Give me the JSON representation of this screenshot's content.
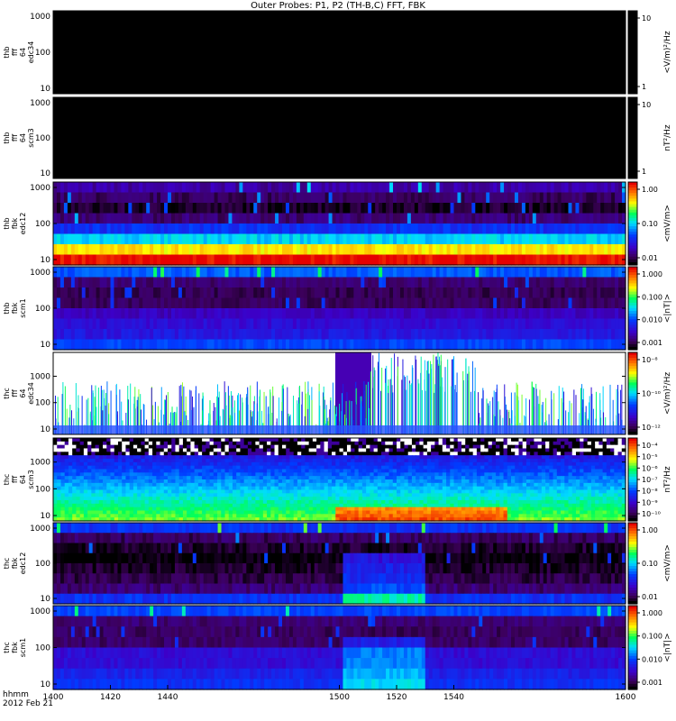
{
  "title": "Outer Probes: P1, P2 (TH-B,C) FFT, FBK",
  "time_axis": {
    "label_line1": "hhmm",
    "label_line2": "2012 Feb 21",
    "ticks": [
      "1400",
      "1420",
      "1440",
      "1500",
      "1520",
      "1540",
      "1600"
    ],
    "range": [
      1400,
      1600
    ]
  },
  "chart_data": [
    {
      "type": "heatmap",
      "panel_label": [
        "thb",
        "fff",
        "64",
        "edc34"
      ],
      "y_scale": "log",
      "ylim": [
        10,
        1000
      ],
      "y_ticks": [
        "1000",
        "100",
        "10"
      ],
      "colorbar_label": "<V/m)²/Hz",
      "colorbar_ticks": [
        "10",
        "1"
      ],
      "colorbar_scale": "log",
      "colorbar_range": [
        1,
        10
      ],
      "status": "no data (solid black)"
    },
    {
      "type": "heatmap",
      "panel_label": [
        "thb",
        "fff",
        "64",
        "scm3"
      ],
      "y_scale": "log",
      "ylim": [
        10,
        1000
      ],
      "y_ticks": [
        "1000",
        "100",
        "10"
      ],
      "colorbar_label": "nT²/Hz",
      "colorbar_ticks": [
        "10",
        "1"
      ],
      "colorbar_scale": "log",
      "colorbar_range": [
        1,
        10
      ],
      "status": "no data (solid black)"
    },
    {
      "type": "heatmap",
      "panel_label": [
        "thb",
        "fbk",
        "edc12"
      ],
      "y_scale": "log",
      "ylim": [
        10,
        1000
      ],
      "y_ticks": [
        "1000",
        "100",
        "10"
      ],
      "colorbar_label": "<mV/m>",
      "colorbar_ticks": [
        "1.00",
        "0.10",
        "0.01"
      ],
      "colorbar_scale": "log",
      "colorbar_range": [
        0.005,
        1.5
      ],
      "band_levels": [
        0.012,
        0.008,
        0.006,
        0.009,
        0.03,
        0.08,
        0.4,
        1.4
      ],
      "time_variation": "steady, sporadic narrow bursts at high frequency"
    },
    {
      "type": "heatmap",
      "panel_label": [
        "thb",
        "fbk",
        "scm1"
      ],
      "y_scale": "log",
      "ylim": [
        10,
        1000
      ],
      "y_ticks": [
        "1000",
        "100",
        "10"
      ],
      "colorbar_label": "<|nT|>",
      "colorbar_ticks": [
        "1.000",
        "0.100",
        "0.010",
        "0.001"
      ],
      "colorbar_scale": "log",
      "colorbar_range": [
        0.0007,
        1.5
      ],
      "band_levels": [
        0.012,
        0.0015,
        0.0012,
        0.0013,
        0.003,
        0.004,
        0.005,
        0.01
      ],
      "time_variation": "steady, weak"
    },
    {
      "type": "heatmap",
      "panel_label": [
        "thc",
        "fff",
        "64",
        "edc34"
      ],
      "y_scale": "log",
      "ylim": [
        10,
        5000
      ],
      "y_ticks": [
        "1000",
        "100",
        "10"
      ],
      "colorbar_label": "<V/m)²/Hz",
      "colorbar_ticks": [
        "10⁻⁸",
        "10⁻¹⁰",
        "10⁻¹²"
      ],
      "colorbar_scale": "log",
      "colorbar_range": [
        1e-13,
        1e-07
      ],
      "background": "white (below threshold)",
      "time_variation": "sparse spiky emissions; enhanced broadband activity 1500–1530"
    },
    {
      "type": "heatmap",
      "panel_label": [
        "thc",
        "fff",
        "64",
        "scm3"
      ],
      "y_scale": "log",
      "ylim": [
        10,
        5000
      ],
      "y_ticks": [
        "1000",
        "100",
        "10"
      ],
      "colorbar_label": "nT²/Hz",
      "colorbar_ticks": [
        "10⁻⁴",
        "10⁻⁵",
        "10⁻⁶",
        "10⁻⁷",
        "10⁻⁸",
        "10⁻⁹",
        "10⁻¹⁰"
      ],
      "colorbar_scale": "log",
      "colorbar_range": [
        1e-11,
        0.001
      ],
      "time_variation": "low-frequency enhancement (red/yellow) 1500–1530"
    },
    {
      "type": "heatmap",
      "panel_label": [
        "thc",
        "fbk",
        "edc12"
      ],
      "y_scale": "log",
      "ylim": [
        10,
        1000
      ],
      "y_ticks": [
        "1000",
        "100",
        "10"
      ],
      "colorbar_label": "<mV/m>",
      "colorbar_ticks": [
        "1.00",
        "0.10",
        "0.01"
      ],
      "colorbar_scale": "log",
      "colorbar_range": [
        0.005,
        1.5
      ],
      "band_levels": [
        0.03,
        0.008,
        0.006,
        0.005,
        0.006,
        0.007,
        0.009,
        0.03
      ],
      "time_variation": "enhancement 1500–1530"
    },
    {
      "type": "heatmap",
      "panel_label": [
        "thc",
        "fbk",
        "scm1"
      ],
      "y_scale": "log",
      "ylim": [
        10,
        1000
      ],
      "y_ticks": [
        "1000",
        "100",
        "10"
      ],
      "colorbar_label": "<|nT|>",
      "colorbar_ticks": [
        "1.000",
        "0.100",
        "0.010",
        "0.001"
      ],
      "colorbar_scale": "log",
      "colorbar_range": [
        0.0007,
        1.5
      ],
      "band_levels": [
        0.01,
        0.0015,
        0.0013,
        0.0014,
        0.004,
        0.004,
        0.006,
        0.008
      ],
      "time_variation": "green enhancement 1500–1525"
    }
  ]
}
